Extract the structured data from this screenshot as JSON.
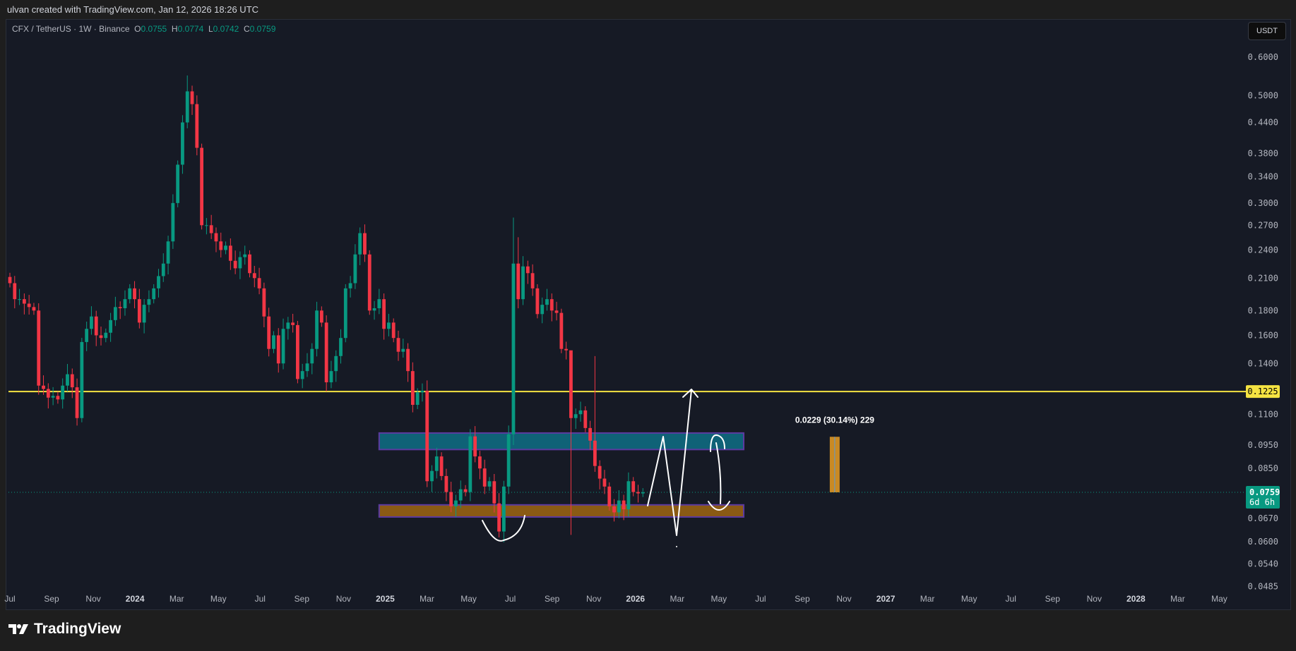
{
  "header": {
    "credit": "ulvan created with TradingView.com, Jan 12, 2026 18:26 UTC"
  },
  "legend": {
    "symbol": "CFX / TetherUS · 1W · Binance",
    "o_label": "O",
    "o": "0.0755",
    "h_label": "H",
    "h": "0.0774",
    "l_label": "L",
    "l": "0.0742",
    "c_label": "C",
    "c": "0.0759"
  },
  "currency_button": "USDT",
  "brand": "TradingView",
  "colors": {
    "up": "#089981",
    "down": "#f23645",
    "level": "#f5e342",
    "zone_resistance": "#0f6277",
    "zone_support": "#8a5a14",
    "zone_border": "#5b3aa0",
    "measure": "#c98a24"
  },
  "chart_data": {
    "type": "candlestick",
    "title": "CFX / TetherUS · 1W · Binance",
    "scale": "log",
    "ylim": [
      0.0485,
      0.62
    ],
    "interval": "1W",
    "first_week": "2023-07-03",
    "close": [
      0.205,
      0.19,
      0.19,
      0.186,
      0.183,
      0.18,
      0.126,
      0.124,
      0.119,
      0.12,
      0.118,
      0.126,
      0.133,
      0.125,
      0.108,
      0.155,
      0.165,
      0.175,
      0.16,
      0.158,
      0.162,
      0.172,
      0.183,
      0.182,
      0.19,
      0.2,
      0.19,
      0.17,
      0.185,
      0.19,
      0.2,
      0.212,
      0.225,
      0.25,
      0.3,
      0.36,
      0.44,
      0.51,
      0.48,
      0.39,
      0.27,
      0.27,
      0.26,
      0.25,
      0.24,
      0.245,
      0.228,
      0.22,
      0.232,
      0.235,
      0.215,
      0.21,
      0.2,
      0.175,
      0.15,
      0.16,
      0.14,
      0.165,
      0.17,
      0.168,
      0.13,
      0.135,
      0.14,
      0.15,
      0.18,
      0.17,
      0.128,
      0.135,
      0.145,
      0.158,
      0.2,
      0.205,
      0.235,
      0.26,
      0.235,
      0.18,
      0.182,
      0.19,
      0.165,
      0.17,
      0.158,
      0.148,
      0.15,
      0.135,
      0.115,
      0.122,
      0.123,
      0.08,
      0.084,
      0.09,
      0.082,
      0.076,
      0.071,
      0.073,
      0.077,
      0.076,
      0.099,
      0.09,
      0.085,
      0.078,
      0.08,
      0.072,
      0.063,
      0.078,
      0.1,
      0.225,
      0.19,
      0.222,
      0.215,
      0.2,
      0.177,
      0.185,
      0.19,
      0.18,
      0.178,
      0.15,
      0.149,
      0.108,
      0.11,
      0.112,
      0.103,
      0.097,
      0.086,
      0.081,
      0.078,
      0.071,
      0.069,
      0.073,
      0.07,
      0.08,
      0.076,
      0.0755,
      0.0759
    ],
    "wick_extremes": [
      {
        "week": 37,
        "high": 0.55
      },
      {
        "week": 105,
        "high": 0.28,
        "low": 0.095
      },
      {
        "week": 106,
        "high": 0.255
      },
      {
        "week": 117,
        "high": 0.145,
        "low": 0.062
      },
      {
        "week": 122,
        "high": 0.145
      },
      {
        "week": 132,
        "open": 0.0755,
        "high": 0.0774,
        "low": 0.0742
      }
    ],
    "y_ticks": [
      "0.6000",
      "0.5000",
      "0.4400",
      "0.3800",
      "0.3400",
      "0.3000",
      "0.2700",
      "0.2400",
      "0.2100",
      "0.1800",
      "0.1600",
      "0.1400",
      "0.1100",
      "0.0950",
      "0.0850",
      "0.0670",
      "0.0600",
      "0.0540",
      "0.0485"
    ],
    "x_ticks": [
      "Jul",
      "Sep",
      "Nov",
      "2024",
      "Mar",
      "May",
      "Jul",
      "Sep",
      "Nov",
      "2025",
      "Mar",
      "May",
      "Jul",
      "Sep",
      "Nov",
      "2026",
      "Mar",
      "May",
      "Jul",
      "Sep",
      "Nov",
      "2027",
      "Mar",
      "May",
      "Jul",
      "Sep",
      "Nov",
      "2028",
      "Mar",
      "May"
    ],
    "horizontal_level": {
      "price": 0.1225,
      "label": "0.1225"
    },
    "current_price": {
      "price": 0.0759,
      "label": "0.0759",
      "countdown": "6d 6h"
    },
    "zones": [
      {
        "name": "resistance-zone",
        "top": 0.1006,
        "bottom": 0.093,
        "from_week": 77,
        "to_week": 153
      },
      {
        "name": "support-zone",
        "top": 0.0715,
        "bottom": 0.0675,
        "from_week": 77,
        "to_week": 153
      }
    ],
    "measure": {
      "from": 0.0759,
      "to": 0.0988,
      "label": "0.0229 (30.14%) 229",
      "week": 172
    }
  }
}
